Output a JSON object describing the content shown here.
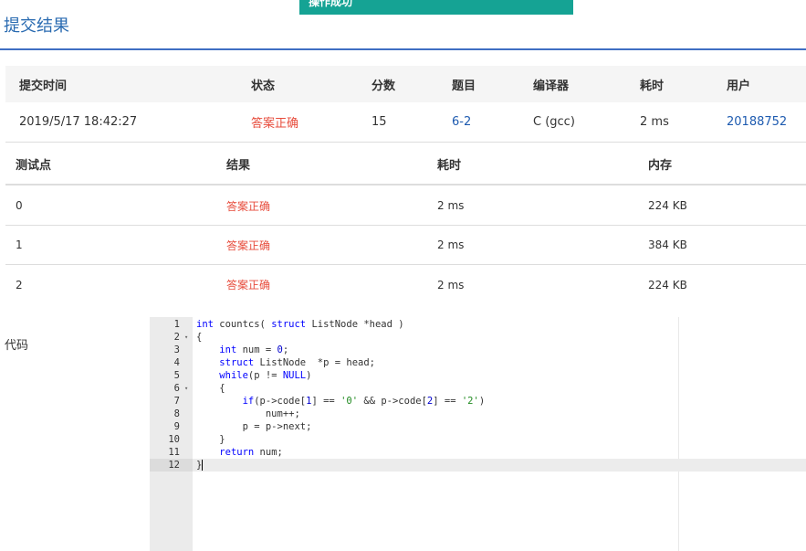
{
  "toast": {
    "text": "操作成功"
  },
  "page": {
    "title": "提交结果"
  },
  "submission": {
    "headers": [
      "提交时间",
      "状态",
      "分数",
      "题目",
      "编译器",
      "耗时",
      "用户"
    ],
    "time": "2019/5/17 18:42:27",
    "status": "答案正确",
    "score": "15",
    "problem": "6-2",
    "compiler": "C (gcc)",
    "elapsed": "2 ms",
    "user": "20188752"
  },
  "testcases": {
    "headers": [
      "测试点",
      "结果",
      "耗时",
      "内存"
    ],
    "rows": [
      {
        "id": "0",
        "result": "答案正确",
        "time": "2 ms",
        "memory": "224 KB"
      },
      {
        "id": "1",
        "result": "答案正确",
        "time": "2 ms",
        "memory": "384 KB"
      },
      {
        "id": "2",
        "result": "答案正确",
        "time": "2 ms",
        "memory": "224 KB"
      }
    ]
  },
  "code": {
    "label": "代码",
    "line_numbers": [
      "1",
      "2",
      "3",
      "4",
      "5",
      "6",
      "7",
      "8",
      "9",
      "10",
      "11",
      "12"
    ],
    "lines": [
      "int countcs( struct ListNode *head )",
      "{",
      "    int num = 0;",
      "    struct ListNode  *p = head;",
      "    while(p != NULL)",
      "    {",
      "        if(p->code[1] == '0' && p->code[2] == '2')",
      "            num++;",
      "        p = p->next;",
      "    }",
      "    return num;",
      "}"
    ]
  }
}
